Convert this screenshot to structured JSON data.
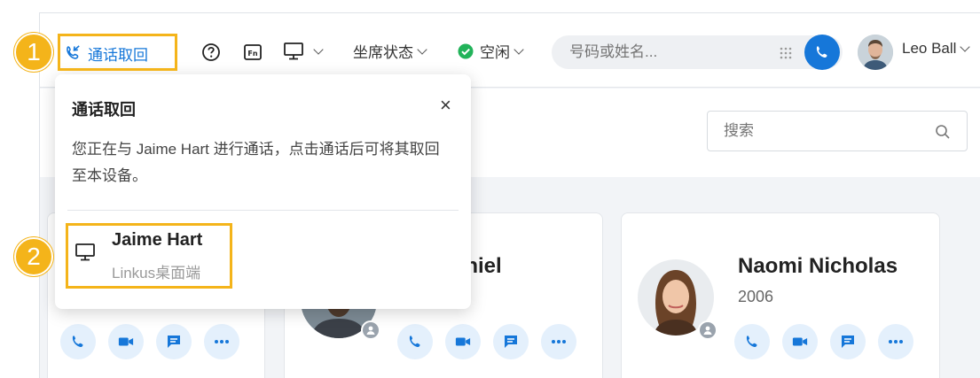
{
  "topbar": {
    "callback_label": "通话取回",
    "agent_status_label": "坐席状态",
    "presence_label": "空闲",
    "search_placeholder": "号码或姓名...",
    "user_name": "Leo Ball"
  },
  "subbar": {
    "search_placeholder": "搜索"
  },
  "popover": {
    "title": "通话取回",
    "close_glyph": "×",
    "message": "您正在与 Jaime Hart 进行通话，点击通话后可将其取回至本设备。",
    "device_name": "Jaime Hart",
    "device_type": "Linkus桌面端"
  },
  "steps": {
    "step1": "1",
    "step2": "2"
  },
  "contacts": [
    {
      "name_partial": "aniel"
    },
    {
      "name": "Naomi Nicholas",
      "ext": "2006"
    }
  ],
  "colors": {
    "accent": "#1677d9",
    "highlight": "#f4b41a",
    "presence_ok": "#22b35a"
  },
  "icons": [
    "callback-icon",
    "help-icon",
    "fn-icon",
    "monitor-icon",
    "check-icon",
    "dialpad-icon",
    "phone-icon",
    "search-icon",
    "video-icon",
    "chat-icon",
    "more-icon",
    "person-icon",
    "close-icon"
  ]
}
